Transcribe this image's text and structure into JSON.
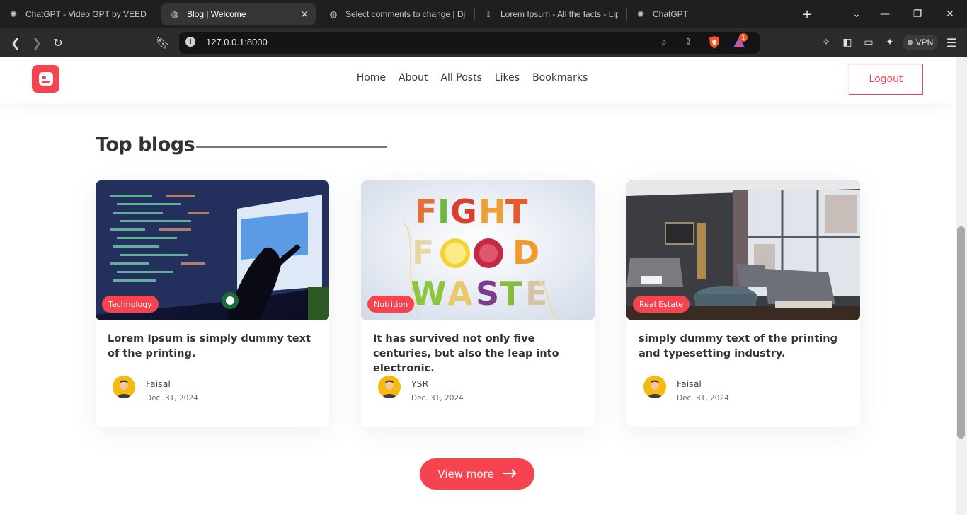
{
  "browser": {
    "tabs": [
      {
        "title": "ChatGPT - Video GPT by VEED",
        "icon": "openai-icon"
      },
      {
        "title": "Blog | Welcome",
        "icon": "globe-icon"
      },
      {
        "title": "Select comments to change | Dja",
        "icon": "globe-icon"
      },
      {
        "title": "Lorem Ipsum - All the facts - Lips",
        "icon": "lipsum-icon"
      },
      {
        "title": "ChatGPT",
        "icon": "openai-icon"
      }
    ],
    "active_tab_close": "✕",
    "new_tab": "+",
    "url": "127.0.0.1:8000",
    "vpn_label": "VPN",
    "notification_count": "1"
  },
  "site": {
    "brand_color": "#f5434f",
    "nav": [
      "Home",
      "About",
      "All Posts",
      "Likes",
      "Bookmarks"
    ],
    "logout_label": "Logout",
    "section_title": "Top blogs",
    "view_more_label": "View more",
    "posts": [
      {
        "tag": "Technology",
        "title": "Lorem Ipsum is simply dummy text of the printing.",
        "author": "Faisal",
        "date": "Dec. 31, 2024"
      },
      {
        "tag": "Nutrition",
        "title": "It has survived not only five centuries, but also the leap into electronic.",
        "author": "YSR",
        "date": "Dec. 31, 2024"
      },
      {
        "tag": "Real Estate",
        "title": "simply dummy text of the printing and typesetting industry.",
        "author": "Faisal",
        "date": "Dec. 31, 2024"
      }
    ]
  }
}
